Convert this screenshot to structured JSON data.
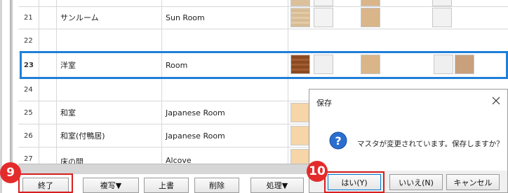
{
  "grid": {
    "rows": [
      {
        "num": "21",
        "ja": "サンルーム",
        "en": "Sun Room"
      },
      {
        "num": "22",
        "ja": "",
        "en": ""
      },
      {
        "num": "23",
        "ja": "洋室",
        "en": "Room"
      },
      {
        "num": "24",
        "ja": "",
        "en": ""
      },
      {
        "num": "25",
        "ja": "和室",
        "en": "Japanese Room"
      },
      {
        "num": "26",
        "ja": "和室(付鴨居)",
        "en": "Japanese Room"
      },
      {
        "num": "27",
        "ja": "床の間",
        "en": "Alcove"
      }
    ]
  },
  "buttons": {
    "finish": "終了",
    "copy": "複写▼",
    "overwrite": "上書",
    "delete": "削除",
    "process": "処理▼"
  },
  "badges": {
    "b9": "9",
    "b10": "10"
  },
  "dialog": {
    "title": "保存",
    "message": "マスタが変更されています。保存しますか？",
    "yes": "はい(Y)",
    "no": "いいえ(N)",
    "cancel": "キャンセル",
    "icon": "question-icon",
    "close_icon": "close-icon"
  },
  "colors": {
    "selection": "#1e7fd8",
    "badge": "#e42b2b",
    "highlight": "#d81e1e"
  }
}
